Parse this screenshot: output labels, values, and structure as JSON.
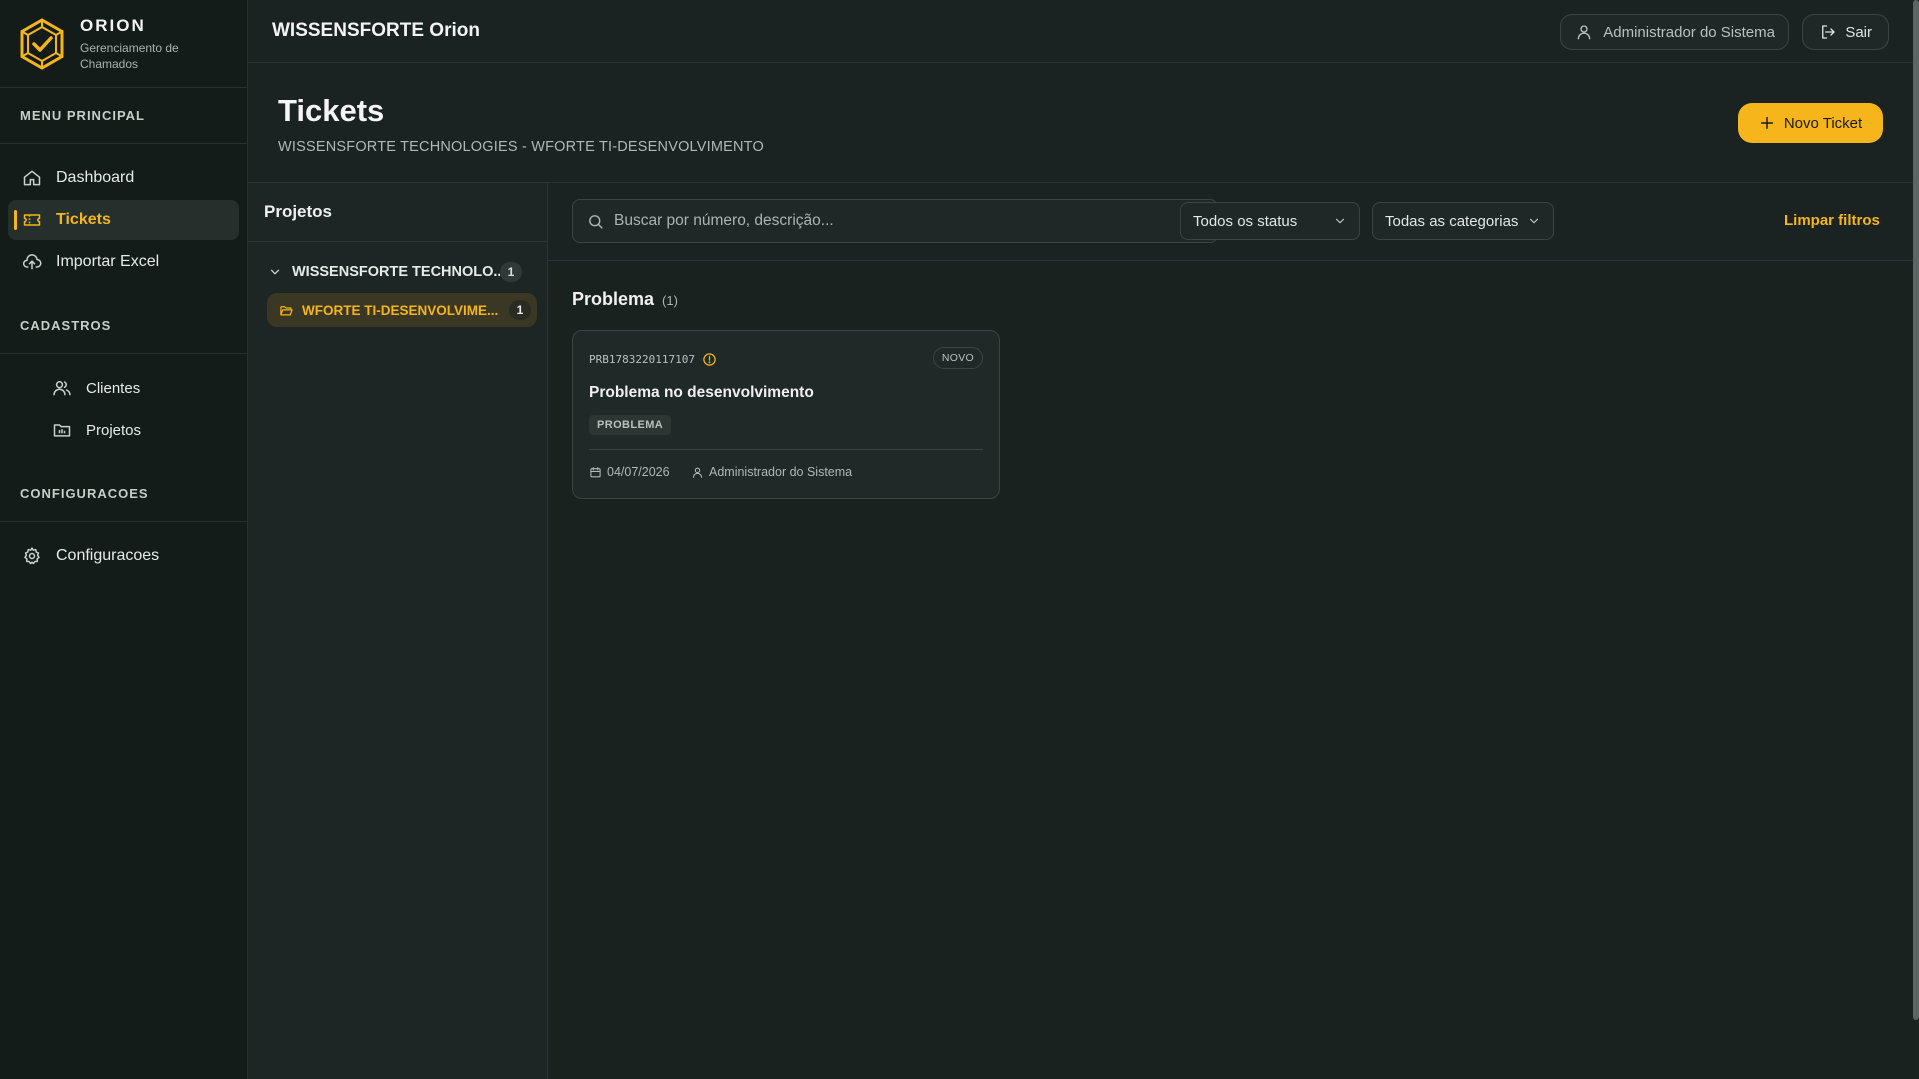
{
  "brand": {
    "name": "ORION",
    "subtitle": "Gerenciamento de Chamados",
    "logo_icon": "hexagon-check-logo",
    "accent": "#f5b51b"
  },
  "sidebar": {
    "sections": [
      {
        "label": "MENU PRINCIPAL",
        "items": [
          {
            "label": "Dashboard",
            "icon": "home-icon",
            "active": false
          },
          {
            "label": "Tickets",
            "icon": "ticket-icon",
            "active": true
          },
          {
            "label": "Importar Excel",
            "icon": "cloud-upload-icon",
            "active": false
          }
        ]
      },
      {
        "label": "CADASTROS",
        "items": [
          {
            "label": "Clientes",
            "icon": "users-icon",
            "active": false
          },
          {
            "label": "Projetos",
            "icon": "folder-icon",
            "active": false
          }
        ]
      },
      {
        "label": "CONFIGURACOES",
        "items": [
          {
            "label": "Configuracoes",
            "icon": "gear-icon",
            "active": false
          }
        ]
      }
    ]
  },
  "topbar": {
    "title": "WISSENSFORTE Orion",
    "user": "Administrador do Sistema",
    "logout": "Sair"
  },
  "header": {
    "title": "Tickets",
    "subtitle": "WISSENSFORTE TECHNOLOGIES - WFORTE TI-DESENVOLVIMENTO",
    "new_ticket": "Novo Ticket"
  },
  "projects": {
    "title": "Projetos",
    "client": {
      "label": "WISSENSFORTE TECHNOLO...",
      "count": "1"
    },
    "project": {
      "label": "WFORTE TI-DESENVOLVIME...",
      "count": "1"
    }
  },
  "filters": {
    "search_placeholder": "Buscar por número, descrição...",
    "status": "Todos os status",
    "category": "Todas as categorias",
    "clear": "Limpar filtros"
  },
  "groups": [
    {
      "title": "Problema",
      "count": "(1)",
      "tickets": [
        {
          "id": "PRB1783220117107",
          "status": "NOVO",
          "title": "Problema no desenvolvimento",
          "category": "PROBLEMA",
          "date": "04/07/2026",
          "user": "Administrador do Sistema"
        }
      ]
    }
  ]
}
